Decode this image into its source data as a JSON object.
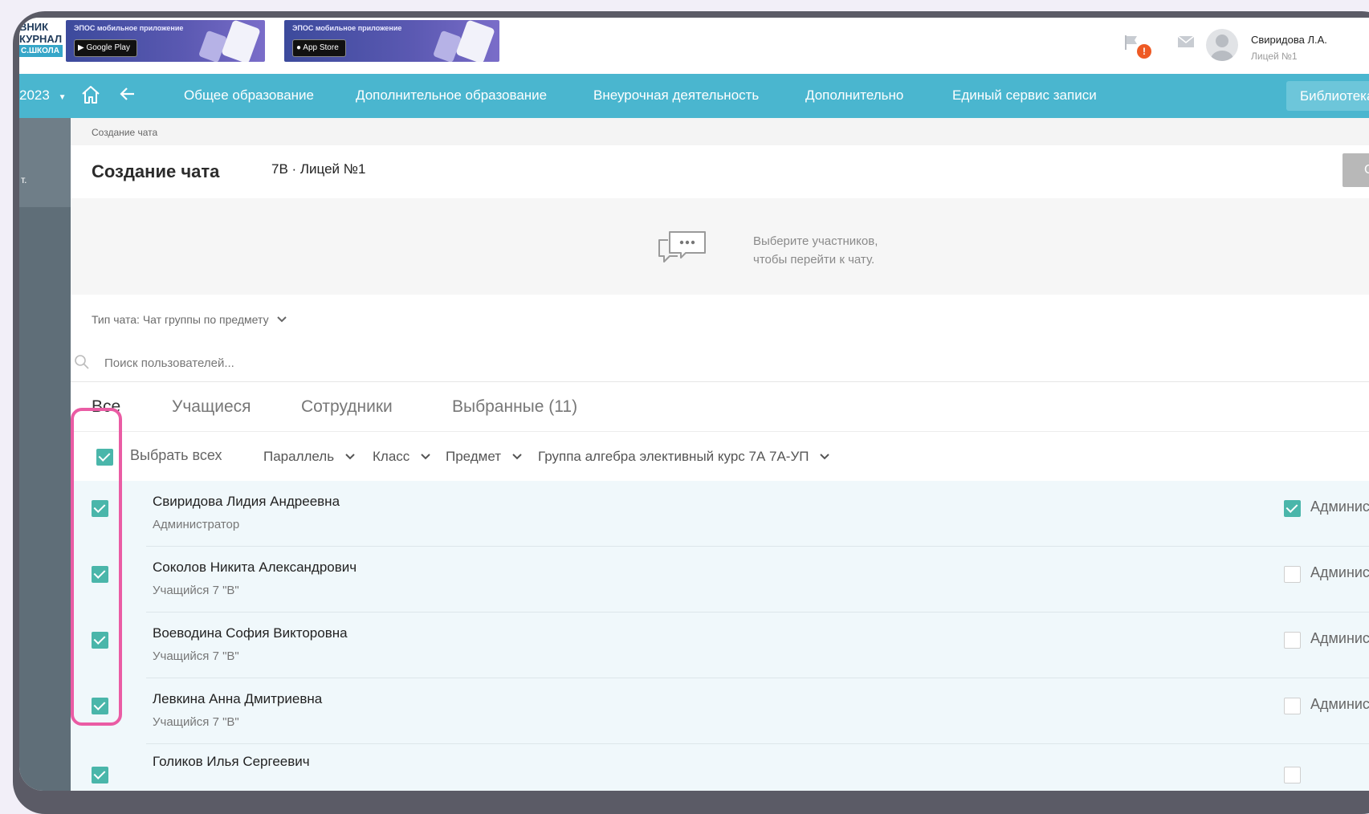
{
  "header": {
    "logo_lines": [
      "ВНИК",
      "КУРНАЛ",
      "С.ШКОЛА"
    ],
    "banners": [
      {
        "title": "ЭПОС мобильное приложение",
        "store": "Google Play"
      },
      {
        "title": "ЭПОС мобильное приложение",
        "store": "App Store"
      }
    ],
    "notification_badge": "!",
    "user_name": "Свиридова Л.А.",
    "user_school": "Лицей №1"
  },
  "nav": {
    "year": "2023",
    "items": [
      "Общее образование",
      "Дополнительное образование",
      "Внеурочная деятельность",
      "Дополнительно",
      "Единый сервис записи"
    ],
    "library": "Библиотека"
  },
  "sidebar": {
    "text": "т."
  },
  "page": {
    "breadcrumb": "Создание чата",
    "title": "Создание чата",
    "subtitle": "7В · Лицей №1",
    "create_button": "Создать",
    "empty_hint": "Выберите участников, чтобы перейти к чату.",
    "chat_type_label": "Тип чата:",
    "chat_type_value": "Чат группы по предмету",
    "search_placeholder": "Поиск пользователей..."
  },
  "tabs": [
    "Все",
    "Учащиеся",
    "Сотрудники",
    "Выбранные (11)"
  ],
  "filters": {
    "select_all": "Выбрать всех",
    "select_all_checked": true,
    "items": [
      "Параллель",
      "Класс",
      "Предмет",
      "Группа алгебра элективный курс 7А 7А-УП"
    ]
  },
  "users": [
    {
      "name": "Свиридова Лидия Андреевна",
      "role": "Администратор",
      "selected": true,
      "admin": true,
      "admin_label": "Админис"
    },
    {
      "name": "Соколов Никита Александрович",
      "role": "Учащийся 7 \"В\"",
      "selected": true,
      "admin": false,
      "admin_label": "Админис"
    },
    {
      "name": "Воеводина София Викторовна",
      "role": "Учащийся 7 \"В\"",
      "selected": true,
      "admin": false,
      "admin_label": "Админис"
    },
    {
      "name": "Левкина Анна Дмитриевна",
      "role": "Учащийся 7 \"В\"",
      "selected": true,
      "admin": false,
      "admin_label": "Админис"
    },
    {
      "name": "Голиков Илья Сергеевич",
      "role": "",
      "selected": true,
      "admin": false,
      "admin_label": ""
    }
  ],
  "colors": {
    "nav": "#4ab6cf",
    "checkbox": "#4ab6aa",
    "highlight": "#ea5ca4"
  }
}
